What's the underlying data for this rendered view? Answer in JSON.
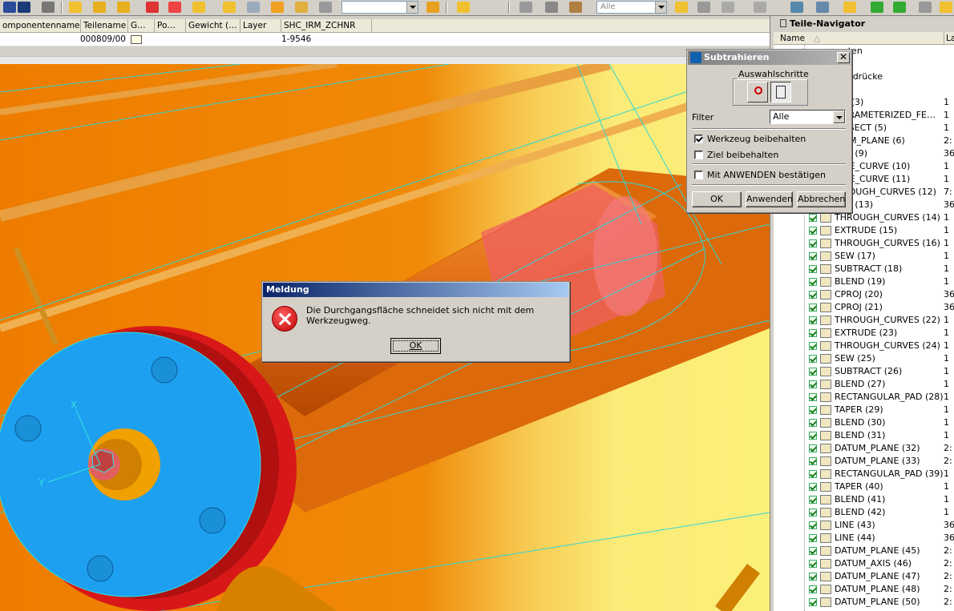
{
  "toolbar": {
    "combo_right_value": "Alle"
  },
  "table": {
    "columns": [
      "omponentenname",
      "Teilename",
      "G…",
      "Po…",
      "Gewicht (…",
      "Layer",
      "SHC_IRM_ZCHNR"
    ],
    "row": {
      "teilename": "000809/00",
      "shc_irm_zchnr": "1-9546"
    }
  },
  "viewport": {
    "axis_x": "X",
    "axis_y": "Y"
  },
  "navigator": {
    "title": "Teile-Navigator",
    "col_name": "Name",
    "col_right": "La",
    "partial_items": [
      {
        "label": "aten",
        "value": ""
      },
      {
        "label": "",
        "value": ""
      },
      {
        "label": "usdrücke",
        "value": ""
      },
      {
        "label": "e",
        "value": ""
      },
      {
        "label": "K (3)",
        "value": "1"
      },
      {
        "label": "ARAMETERIZED_FE…",
        "value": "1"
      },
      {
        "label": "RSECT (5)",
        "value": "1"
      },
      {
        "label": "UM_PLANE (6)",
        "value": "2:"
      },
      {
        "label": "OJ (9)",
        "value": "36"
      },
      {
        "label": "GE_CURVE (10)",
        "value": "1"
      },
      {
        "label": "GE_CURVE (11)",
        "value": "1"
      },
      {
        "label": "ROUGH_CURVES (12)",
        "value": "7:"
      },
      {
        "label": "OJ (13)",
        "value": "36"
      }
    ],
    "items": [
      {
        "label": "THROUGH_CURVES (14)",
        "value": "1"
      },
      {
        "label": "EXTRUDE (15)",
        "value": "1"
      },
      {
        "label": "THROUGH_CURVES (16)",
        "value": "1"
      },
      {
        "label": "SEW (17)",
        "value": "1"
      },
      {
        "label": "SUBTRACT (18)",
        "value": "1"
      },
      {
        "label": "BLEND (19)",
        "value": "1"
      },
      {
        "label": "CPROJ (20)",
        "value": "36"
      },
      {
        "label": "CPROJ (21)",
        "value": "36"
      },
      {
        "label": "THROUGH_CURVES (22)",
        "value": "1"
      },
      {
        "label": "EXTRUDE (23)",
        "value": "1"
      },
      {
        "label": "THROUGH_CURVES (24)",
        "value": "1"
      },
      {
        "label": "SEW (25)",
        "value": "1"
      },
      {
        "label": "SUBTRACT (26)",
        "value": "1"
      },
      {
        "label": "BLEND (27)",
        "value": "1"
      },
      {
        "label": "RECTANGULAR_PAD (28)",
        "value": "1"
      },
      {
        "label": "TAPER (29)",
        "value": "1"
      },
      {
        "label": "BLEND (30)",
        "value": "1"
      },
      {
        "label": "BLEND (31)",
        "value": "1"
      },
      {
        "label": "DATUM_PLANE (32)",
        "value": "2:"
      },
      {
        "label": "DATUM_PLANE (33)",
        "value": "2:"
      },
      {
        "label": "RECTANGULAR_PAD (39)",
        "value": "1"
      },
      {
        "label": "TAPER (40)",
        "value": "1"
      },
      {
        "label": "BLEND (41)",
        "value": "1"
      },
      {
        "label": "BLEND (42)",
        "value": "1"
      },
      {
        "label": "LINE (43)",
        "value": "36"
      },
      {
        "label": "LINE (44)",
        "value": "36"
      },
      {
        "label": "DATUM_PLANE (45)",
        "value": "2:"
      },
      {
        "label": "DATUM_AXIS (46)",
        "value": "2:"
      },
      {
        "label": "DATUM_PLANE (47)",
        "value": "2:"
      },
      {
        "label": "DATUM_PLANE (48)",
        "value": "2:"
      },
      {
        "label": "DATUM_PLANE (50)",
        "value": "2:"
      }
    ]
  },
  "subtract_dialog": {
    "title": "Subtrahieren",
    "group_label": "Auswahlschritte",
    "filter_label": "Filter",
    "filter_value": "Alle",
    "keep_tool": "Werkzeug beibehalten",
    "keep_target": "Ziel beibehalten",
    "confirm_apply": "Mit ANWENDEN bestätigen",
    "ok": "OK",
    "apply": "Anwenden",
    "cancel": "Abbrechen",
    "close": "✕"
  },
  "message_dialog": {
    "title": "Meldung",
    "text": "Die Durchgangsfläche schneidet sich nicht mit dem Werkzeugweg.",
    "ok": "OK"
  }
}
